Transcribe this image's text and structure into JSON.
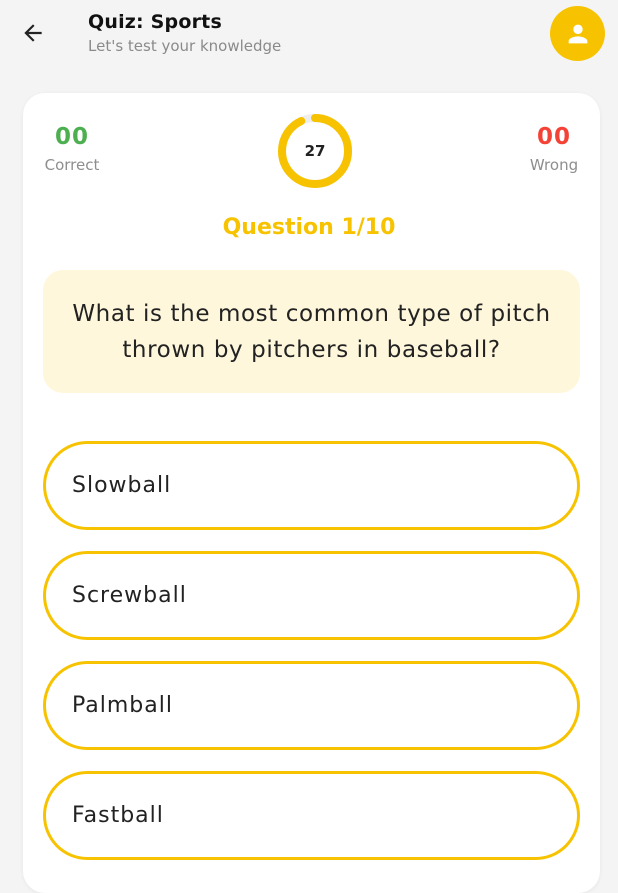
{
  "header": {
    "title": "Quiz: Sports",
    "subtitle": "Let's test your knowledge",
    "back_icon": "arrow-left-icon",
    "profile_icon": "person-icon"
  },
  "scoreboard": {
    "correct_count": "00",
    "correct_label": "Correct",
    "wrong_count": "00",
    "wrong_label": "Wrong",
    "timer_value": "27",
    "timer_progress": 0.93
  },
  "question": {
    "counter": "Question 1/10",
    "text": "What is the most common type of pitch thrown by pitchers in baseball?"
  },
  "options": [
    {
      "label": "Slowball"
    },
    {
      "label": "Screwball"
    },
    {
      "label": "Palmball"
    },
    {
      "label": "Fastball"
    }
  ],
  "colors": {
    "accent": "#f7c300",
    "correct": "#4caf50",
    "wrong": "#f44336",
    "question_bg": "#fff7dc",
    "page_bg": "#f4f4f4"
  }
}
